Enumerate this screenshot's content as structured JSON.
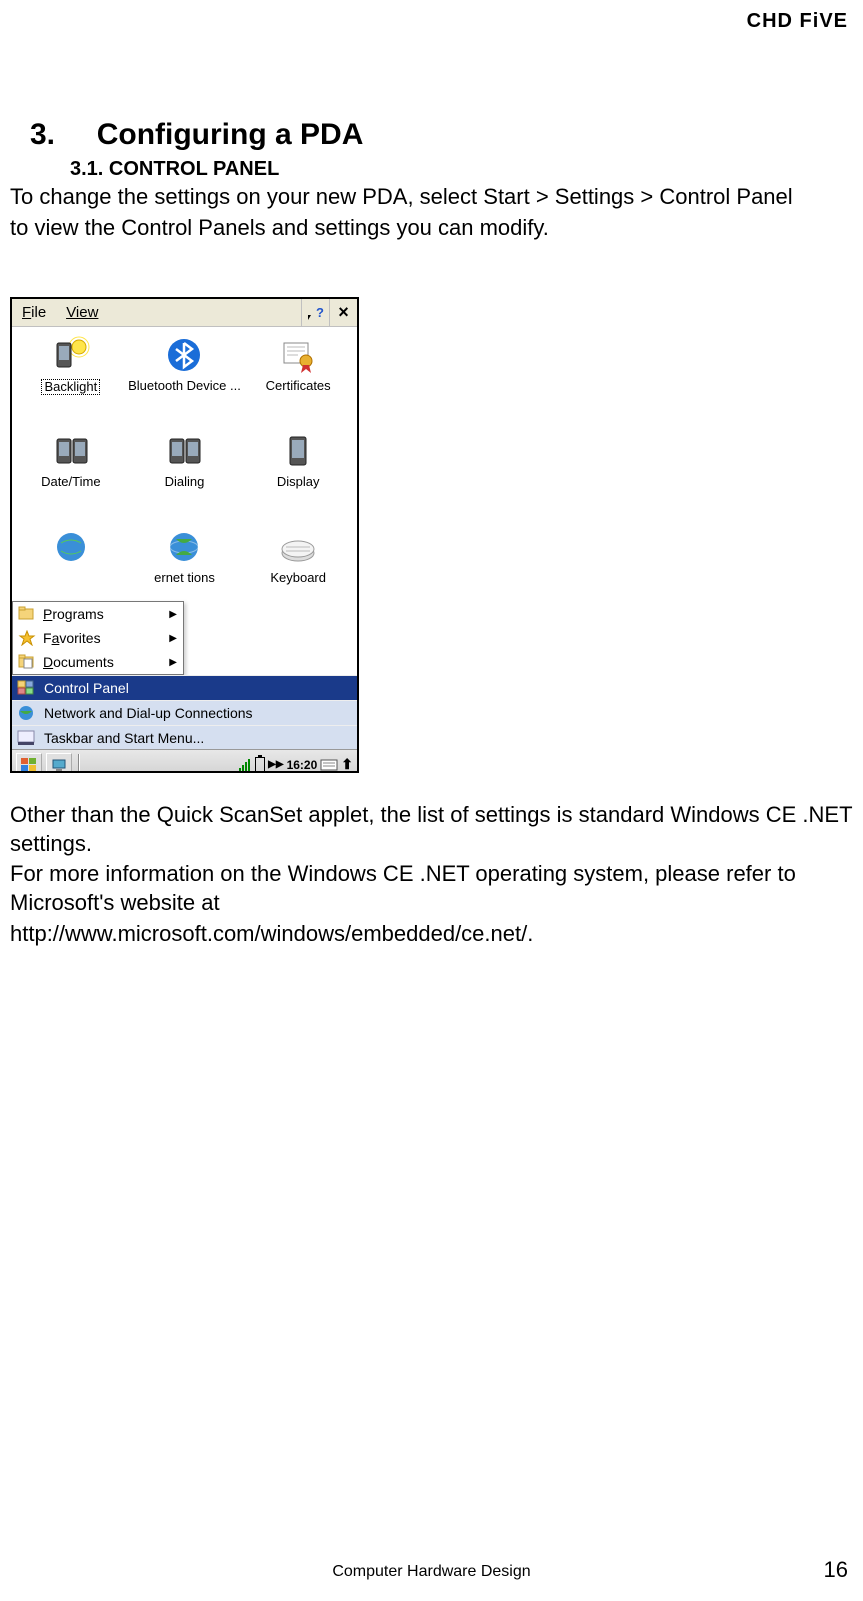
{
  "header": {
    "brand": "CHD FiVE"
  },
  "section": {
    "number": "3.",
    "title": "Configuring a PDA"
  },
  "subsection": {
    "number": "3.1.",
    "title_prefix": "C",
    "title_rest": "ONTROL PANEL"
  },
  "para1a": "To change the settings on your new PDA, select Start > Settings > Control Panel",
  "para1b": "to view the Control Panels and settings you can modify.",
  "pda": {
    "menubar": {
      "file": "File",
      "view": "View"
    },
    "items": [
      {
        "label": "Backlight",
        "selected": true
      },
      {
        "label": "Bluetooth Device ..."
      },
      {
        "label": "Certificates"
      },
      {
        "label": "Date/Time"
      },
      {
        "label": "Dialing"
      },
      {
        "label": "Display"
      },
      {
        "label": ""
      },
      {
        "label": "ernet tions"
      },
      {
        "label": "Keyboard"
      }
    ],
    "submenu": {
      "programs": "Programs",
      "favorites": "Favorites",
      "documents": "Documents"
    },
    "startmenu": {
      "control_panel": "Control Panel",
      "network": "Network and Dial-up Connections",
      "taskbar": "Taskbar and Start Menu..."
    },
    "taskbar": {
      "time": "16:20"
    }
  },
  "para2a": "Other than the Quick ScanSet applet, the list of settings is standard Windows CE .NET settings.",
  "para2b": "For more information on the Windows CE .NET operating system, please refer to Microsoft's website at",
  "para2c": "http://www.microsoft.com/windows/embedded/ce.net/.",
  "footer": {
    "center": "Computer Hardware Design",
    "page": "16"
  }
}
